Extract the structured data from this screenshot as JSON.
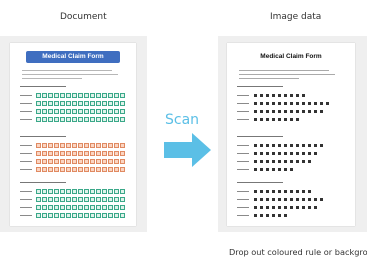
{
  "labels": {
    "document": "Document",
    "image_data": "Image data",
    "scan": "Scan",
    "note": "Drop out coloured rule or background"
  },
  "form": {
    "title": "Medical Claim Form"
  },
  "colors": {
    "title_blue": "#3f6ec0",
    "green_cell": "#3aa889",
    "orange_cell": "#e08a62",
    "arrow": "#5bbfe6"
  },
  "icons": {
    "arrow": "right-arrow-icon"
  }
}
